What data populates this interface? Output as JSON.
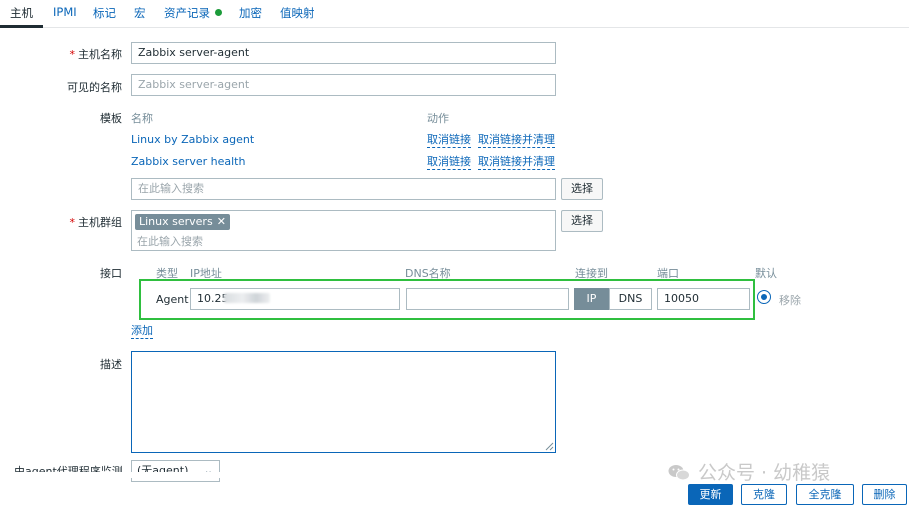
{
  "tabs": [
    {
      "label": "主机"
    },
    {
      "label": "IPMI"
    },
    {
      "label": "标记"
    },
    {
      "label": "宏"
    },
    {
      "label": "资产记录"
    },
    {
      "label": "加密"
    },
    {
      "label": "值映射"
    }
  ],
  "form": {
    "host_name_label": "主机名称",
    "host_name_value": "Zabbix server-agent",
    "visible_name_label": "可见的名称",
    "visible_name_placeholder": "Zabbix server-agent",
    "templates_label": "模板",
    "templates_header_name": "名称",
    "templates_header_action": "动作",
    "templates": [
      {
        "name": "Linux by Zabbix agent",
        "unlink": "取消链接",
        "unlink_clear": "取消链接并清理"
      },
      {
        "name": "Zabbix server health",
        "unlink": "取消链接",
        "unlink_clear": "取消链接并清理"
      }
    ],
    "template_search_placeholder": "在此输入搜索",
    "select_label": "选择",
    "host_groups_label": "主机群组",
    "host_group_chip": "Linux servers",
    "host_group_search_placeholder": "在此输入搜索",
    "interfaces_label": "接口",
    "interfaces_headers": {
      "type": "类型",
      "ip": "IP地址",
      "dns": "DNS名称",
      "connect_to": "连接到",
      "port": "端口",
      "default": "默认"
    },
    "interface": {
      "type": "Agent",
      "ip": "10.25",
      "dns": "",
      "ip_toggle": "IP",
      "dns_toggle": "DNS",
      "port": "10050",
      "remove": "移除"
    },
    "add_label": "添加",
    "description_label": "描述",
    "monitored_by_label": "由agent代理程序监测",
    "monitored_by_value": "(无agent)"
  },
  "footer": {
    "update": "更新",
    "clone": "克隆",
    "full_clone": "全克隆",
    "delete": "删除"
  },
  "watermark": "公众号 · 幼稚猿",
  "colors": {
    "accent": "#0a66b8",
    "highlight_box": "#2fbf3f",
    "status_dot": "#1c9b3a"
  }
}
